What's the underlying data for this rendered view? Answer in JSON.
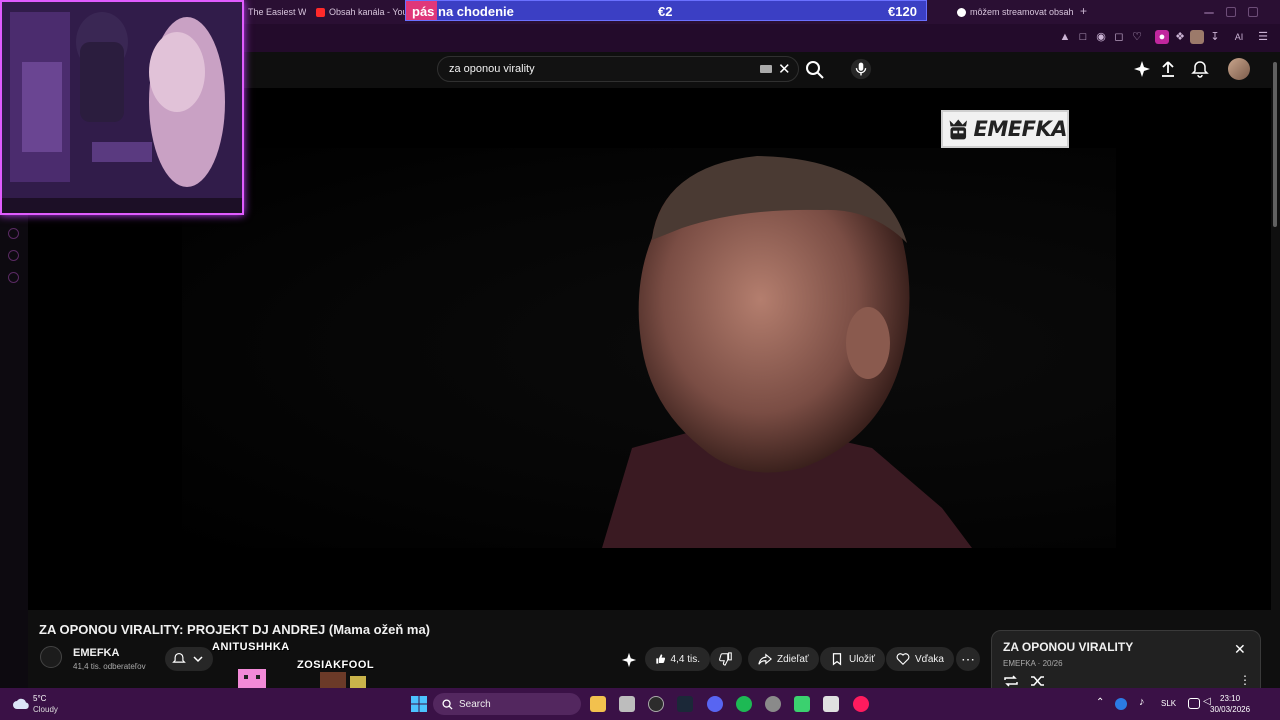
{
  "browser": {
    "tabs": [
      {
        "label": "The Easiest W",
        "color": "#d1a34b"
      },
      {
        "label": "Obsah kanála - You",
        "color": "#ff2a2a"
      },
      {
        "label": "môžem streamovat obsah",
        "color": "#4285f4"
      }
    ],
    "new_tab_symbol": "+",
    "ai_label": "AI"
  },
  "donation": {
    "label": "pás na chodenie",
    "current": "€2",
    "goal": "€120",
    "progress_fraction": 0.017,
    "bar_color": "#3b3fc4",
    "fill_color": "#e0377a"
  },
  "youtube": {
    "search_value": "za oponou virality",
    "search_icon": "search-icon",
    "mic_icon": "mic-icon",
    "header_icons": [
      "create-sparkle-icon",
      "upload-icon",
      "bell-icon"
    ],
    "video_logo_text": "EMEFKA",
    "title": "ZA OPONOU VIRALITY: PROJEKT DJ ANDREJ (Mama ožeň ma)",
    "channel_name": "EMEFKA",
    "channel_subs": "41,4 tis. odberateľov",
    "like_count": "4,4 tis.",
    "share_label": "Zdieľať",
    "save_label": "Uložiť",
    "thanks_label": "Vďaka",
    "accent": "#ff0000"
  },
  "playlist": {
    "title": "ZA OPONOU VIRALITY",
    "subtitle": "EMEFKA · 20/26",
    "close_symbol": "✕"
  },
  "overlay": {
    "name1": "ANITUSHHKA",
    "name2": "ZOSIAKFOOL"
  },
  "taskbar": {
    "weather_temp": "5°C",
    "weather_desc": "Cloudy",
    "search_placeholder": "Search",
    "language": "SLK",
    "time": "23:10",
    "date": "30/03/2026"
  }
}
